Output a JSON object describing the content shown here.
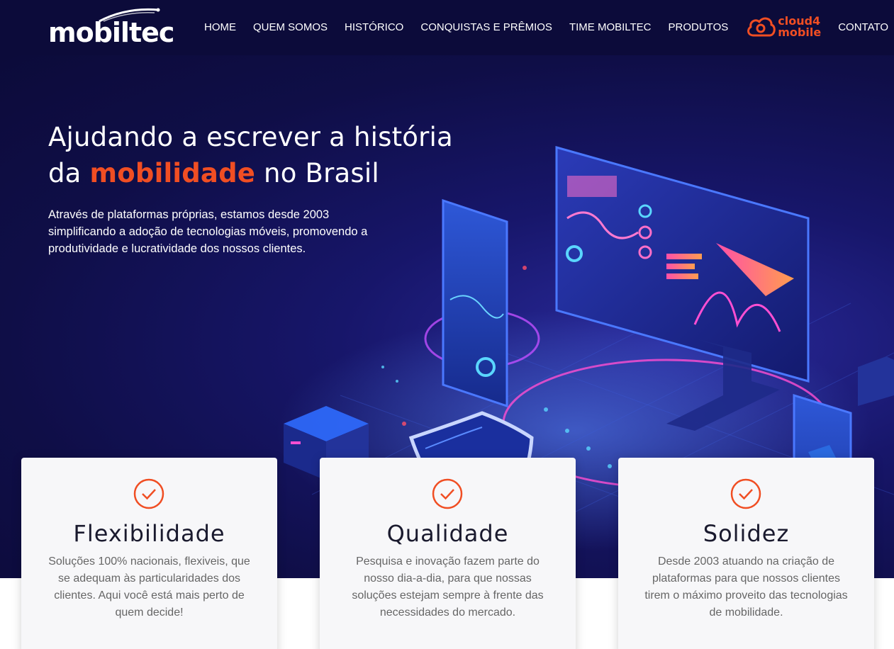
{
  "header": {
    "logo_text": "mobiltec",
    "nav": [
      {
        "label": "HOME"
      },
      {
        "label": "QUEM SOMOS"
      },
      {
        "label": "HISTÓRICO"
      },
      {
        "label": "CONQUISTAS E PRÊMIOS"
      },
      {
        "label": "TIME MOBILTEC"
      },
      {
        "label": "PRODUTOS"
      }
    ],
    "cloud_logo": {
      "line1": "cloud4",
      "line2": "mobile"
    },
    "contact_label": "CONTATO"
  },
  "hero": {
    "title_line1": "Ajudando a escrever a história",
    "title_pre": "da ",
    "title_accent": "mobilidade",
    "title_post": " no Brasil",
    "subtitle": "Através de plataformas próprias, estamos desde 2003 simplificando a adoção de tecnologias móveis, promovendo a produtividade e lucratividade dos nossos clientes."
  },
  "cards": [
    {
      "title": "Flexibilidade",
      "text": "Soluções 100% nacionais, flexiveis, que se adequam às particularidades dos clientes. Aqui você está mais perto de quem decide!"
    },
    {
      "title": "Qualidade",
      "text": "Pesquisa e inovação fazem parte do nosso dia-a-dia, para que nossas soluções estejam sempre à frente das necessidades do mercado."
    },
    {
      "title": "Solidez",
      "text": "Desde 2003 atuando na criação de plataformas para que nossos clientes tirem o máximo proveito das tecnologias de mobilidade."
    }
  ],
  "colors": {
    "accent": "#f04e23",
    "header_bg": "#0c0b3a",
    "hero_bg": "#17166a",
    "card_bg": "#f7f7f9"
  },
  "icons": {
    "card": "check-circle-icon",
    "cloud": "cloud-logo-icon",
    "logo": "swoosh-icon"
  }
}
